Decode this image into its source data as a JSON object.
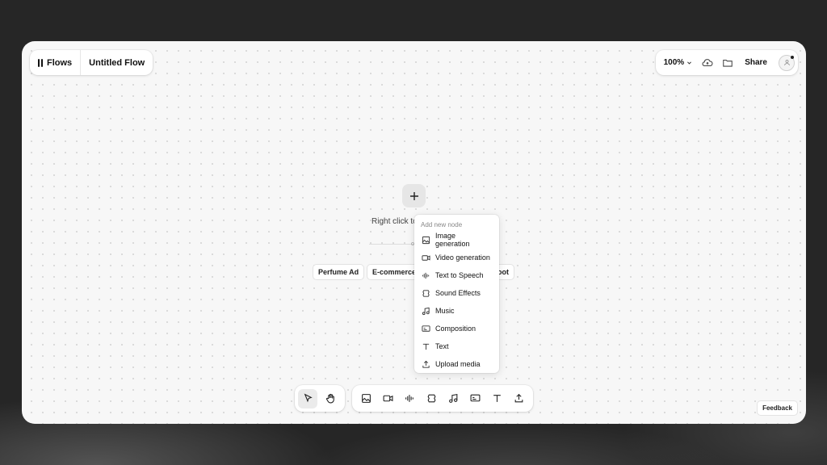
{
  "brand": {
    "name": "Flows"
  },
  "flow": {
    "title": "Untitled Flow"
  },
  "header": {
    "zoom": "100%",
    "share_label": "Share"
  },
  "canvas": {
    "hint": "Right click to",
    "or_label": "o",
    "templates": [
      "Perfume Ad",
      "E-commerce",
      "oot"
    ]
  },
  "context_menu": {
    "heading": "Add new node",
    "items": [
      {
        "label": "Image generation",
        "icon": "image-icon"
      },
      {
        "label": "Video generation",
        "icon": "video-icon"
      },
      {
        "label": "Text to Speech",
        "icon": "waveform-icon"
      },
      {
        "label": "Sound Effects",
        "icon": "sound-effects-icon"
      },
      {
        "label": "Music",
        "icon": "music-note-icon"
      },
      {
        "label": "Composition",
        "icon": "composition-icon"
      },
      {
        "label": "Text",
        "icon": "text-icon"
      },
      {
        "label": "Upload media",
        "icon": "upload-icon"
      }
    ]
  },
  "toolbar": {
    "tools": [
      {
        "icon": "pointer-icon",
        "active": true
      },
      {
        "icon": "hand-icon",
        "active": false
      }
    ],
    "nodes": [
      "image-icon",
      "video-icon",
      "waveform-icon",
      "sound-effects-icon",
      "music-note-icon",
      "composition-icon",
      "text-icon",
      "upload-icon"
    ]
  },
  "feedback_label": "Feedback"
}
